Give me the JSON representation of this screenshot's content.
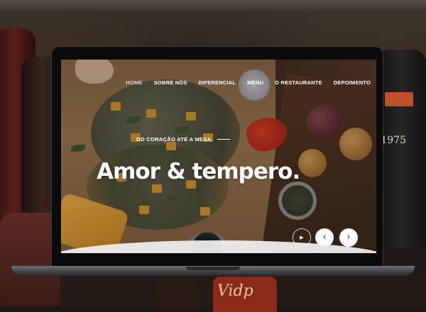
{
  "nav": {
    "items": [
      "HOME",
      "SOBRE NÓS",
      "DIFERENCIAL",
      "MENU",
      "O RESTAURANTE",
      "DEPOIMENTO"
    ],
    "active": "HOME"
  },
  "hero": {
    "tagline": "DO CORAÇÃO ATÉ A MESA.",
    "headline": "Amor & tempero."
  },
  "controls": {
    "play_icon": "▶",
    "prev_icon": "‹",
    "next_icon": "›"
  },
  "background": {
    "bottle_text": "Vidp",
    "bottle_label": "1975"
  },
  "colors": {
    "nav_text": "#ffffff",
    "headline": "#ffffff",
    "control_bg": "#ffffff"
  }
}
